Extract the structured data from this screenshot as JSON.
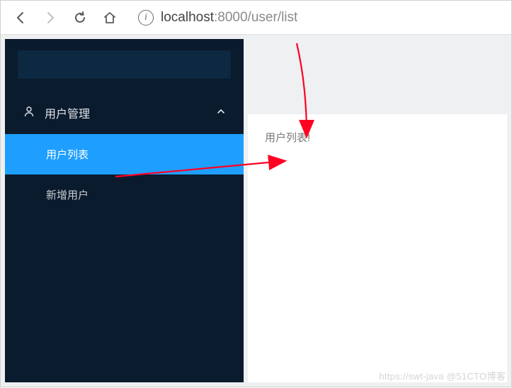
{
  "browser": {
    "url_host": "localhost",
    "url_port_path": ":8000/user/list"
  },
  "sidebar": {
    "group": {
      "label": "用户管理"
    },
    "items": [
      {
        "label": "用户列表",
        "active": true
      },
      {
        "label": "新增用户",
        "active": false
      }
    ]
  },
  "main": {
    "content_text": "用户列表!"
  },
  "watermark": "https://swt-java @51CTO博客",
  "colors": {
    "sidebar_bg": "#0a1b2e",
    "active_bg": "#1e9fff",
    "arrow": "#ff0022"
  }
}
